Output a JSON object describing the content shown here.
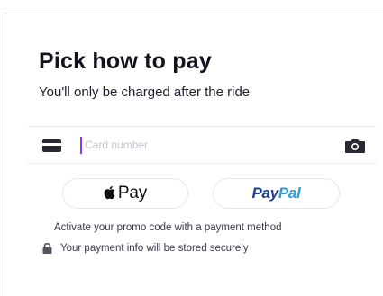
{
  "header": {
    "title": "Pick how to pay",
    "subtitle": "You'll only be charged after the ride"
  },
  "card_field": {
    "placeholder": "Card number",
    "value": "",
    "leading_icon": "credit-card-icon",
    "trailing_icon": "camera-icon",
    "caret_color": "#8a3cf2"
  },
  "payment_options": {
    "apple_pay": {
      "icon": "apple-icon",
      "label": "Pay"
    },
    "paypal": {
      "label_part1": "Pay",
      "label_part2": "Pal",
      "color_part1": "#1f3f94",
      "color_part2": "#2c9ad6"
    }
  },
  "footer": {
    "promo_text": "Activate your promo code with a payment method",
    "secure_text": "Your payment info will be stored securely",
    "secure_icon": "lock-icon"
  }
}
